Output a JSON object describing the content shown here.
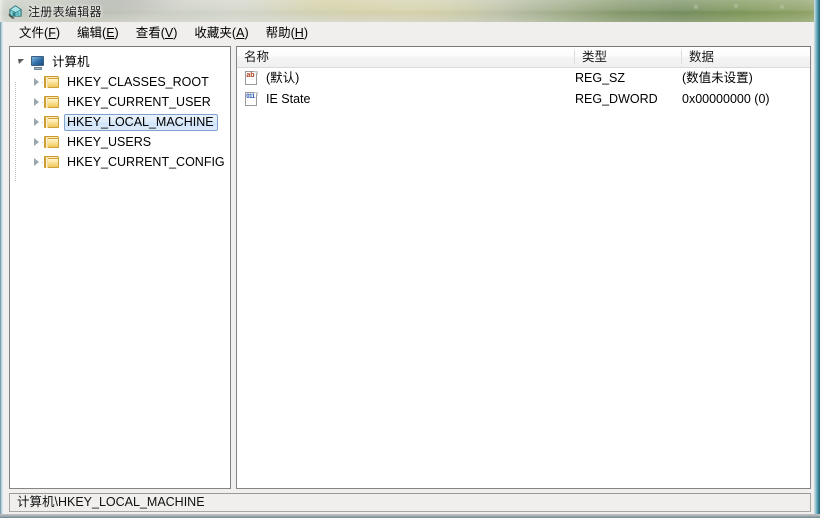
{
  "window": {
    "title": "注册表编辑器",
    "icon": "registry-editor-icon"
  },
  "menubar": {
    "items": [
      {
        "label": "文件",
        "accel": "F"
      },
      {
        "label": "编辑",
        "accel": "E"
      },
      {
        "label": "查看",
        "accel": "V"
      },
      {
        "label": "收藏夹",
        "accel": "A"
      },
      {
        "label": "帮助",
        "accel": "H"
      }
    ]
  },
  "tree": {
    "root": {
      "label": "计算机",
      "icon": "computer-icon",
      "expanded": true
    },
    "nodes": [
      {
        "label": "HKEY_CLASSES_ROOT",
        "icon": "folder-icon",
        "selected": false
      },
      {
        "label": "HKEY_CURRENT_USER",
        "icon": "folder-icon",
        "selected": false
      },
      {
        "label": "HKEY_LOCAL_MACHINE",
        "icon": "folder-icon",
        "selected": true
      },
      {
        "label": "HKEY_USERS",
        "icon": "folder-icon",
        "selected": false
      },
      {
        "label": "HKEY_CURRENT_CONFIG",
        "icon": "folder-icon",
        "selected": false
      }
    ]
  },
  "listview": {
    "columns": [
      {
        "key": "name",
        "label": "名称"
      },
      {
        "key": "type",
        "label": "类型"
      },
      {
        "key": "data",
        "label": "数据"
      }
    ],
    "rows": [
      {
        "name": "(默认)",
        "type": "REG_SZ",
        "data": "(数值未设置)",
        "icon": "registry-string-value-icon",
        "icon_glyph": "ab"
      },
      {
        "name": "IE State",
        "type": "REG_DWORD",
        "data": "0x00000000 (0)",
        "icon": "registry-dword-value-icon",
        "icon_glyph": "011"
      }
    ]
  },
  "statusbar": {
    "path": "计算机\\HKEY_LOCAL_MACHINE"
  },
  "colors": {
    "selection_border": "#7da2ce",
    "selection_fill": "#dcebfa",
    "folder_yellow": "#f0c65c",
    "frame_edge": "#2c6273"
  }
}
